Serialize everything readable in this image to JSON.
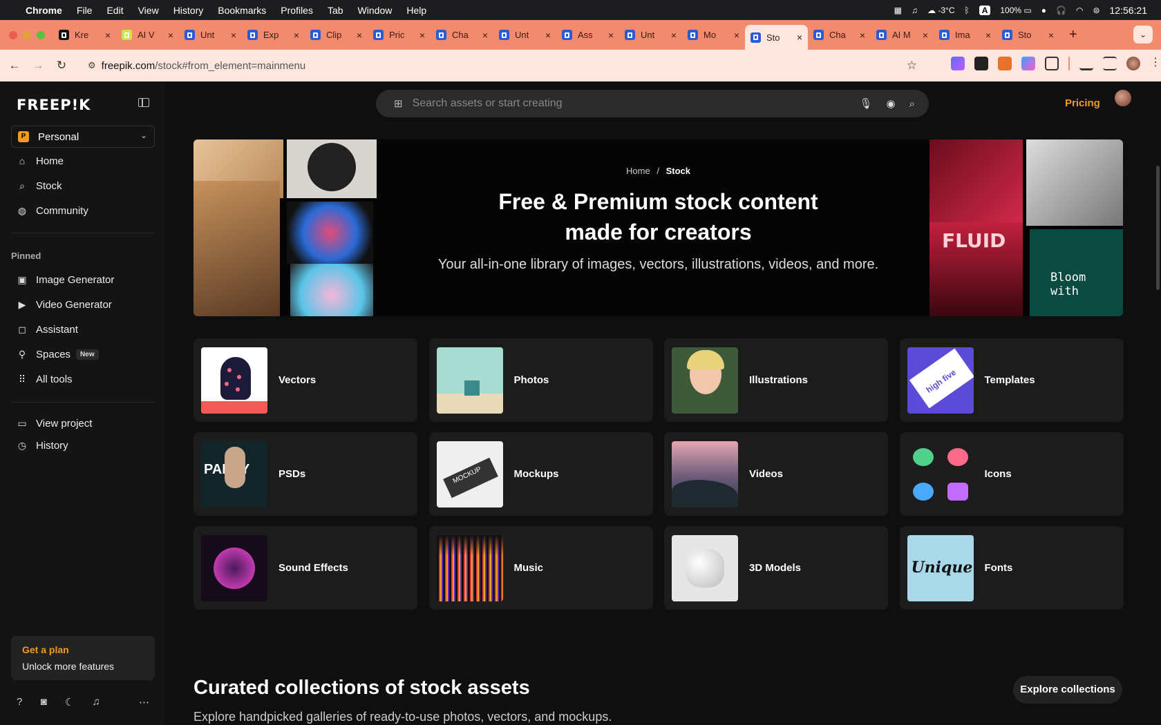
{
  "menubar": {
    "apple": "",
    "items": [
      "Chrome",
      "File",
      "Edit",
      "View",
      "History",
      "Bookmarks",
      "Profiles",
      "Tab",
      "Window",
      "Help"
    ],
    "status": {
      "weather": "-3°C",
      "battery": "100%",
      "clock": "12:56:21"
    }
  },
  "tabs": [
    {
      "label": "Kre",
      "color": "#111"
    },
    {
      "label": "AI V",
      "color": "#c7e84a"
    },
    {
      "label": "Unt",
      "color": "#2a5bd7"
    },
    {
      "label": "Exp",
      "color": "#2a5bd7"
    },
    {
      "label": "Clip",
      "color": "#2a5bd7"
    },
    {
      "label": "Pric",
      "color": "#2a5bd7"
    },
    {
      "label": "Cha",
      "color": "#2a5bd7"
    },
    {
      "label": "Unt",
      "color": "#2a5bd7"
    },
    {
      "label": "Ass",
      "color": "#2a5bd7"
    },
    {
      "label": "Unt",
      "color": "#2a5bd7"
    },
    {
      "label": "Mo",
      "color": "#2a5bd7"
    },
    {
      "label": "Sto",
      "color": "#2a5bd7",
      "active": true
    },
    {
      "label": "Cha",
      "color": "#2a5bd7"
    },
    {
      "label": "AI M",
      "color": "#2a5bd7"
    },
    {
      "label": "Ima",
      "color": "#2a5bd7"
    },
    {
      "label": "Sto",
      "color": "#2a5bd7"
    }
  ],
  "address": {
    "host": "freepik.com",
    "path": "/stock#from_element=mainmenu"
  },
  "sidebar": {
    "logo": "FREEP!K",
    "workspace": {
      "badge": "P",
      "label": "Personal"
    },
    "nav": [
      {
        "label": "Home",
        "icon": "home-icon"
      },
      {
        "label": "Stock",
        "icon": "search-icon"
      },
      {
        "label": "Community",
        "icon": "globe-icon"
      }
    ],
    "pinned_label": "Pinned",
    "pinned": [
      {
        "label": "Image Generator",
        "icon": "image-icon"
      },
      {
        "label": "Video Generator",
        "icon": "video-icon"
      },
      {
        "label": "Assistant",
        "icon": "chat-icon"
      },
      {
        "label": "Spaces",
        "icon": "spaces-icon",
        "badge": "New"
      },
      {
        "label": "All tools",
        "icon": "grid-icon"
      }
    ],
    "project": [
      {
        "label": "View project",
        "icon": "folder-icon"
      },
      {
        "label": "History",
        "icon": "history-icon"
      }
    ],
    "plan": {
      "title": "Get a plan",
      "subtitle": "Unlock more features"
    }
  },
  "header": {
    "search_placeholder": "Search assets or start creating",
    "pricing": "Pricing"
  },
  "hero": {
    "breadcrumb": {
      "home": "Home",
      "sep": "/",
      "current": "Stock"
    },
    "title": "Free & Premium stock content made for creators",
    "subtitle": "Your all-in-one library of images, vectors, illustrations, videos, and more.",
    "art_text": [
      "FLUID",
      "Bloom with"
    ]
  },
  "categories": [
    {
      "label": "Vectors",
      "thumb": "vectors"
    },
    {
      "label": "Photos",
      "thumb": "photos"
    },
    {
      "label": "Illustrations",
      "thumb": "illustrations"
    },
    {
      "label": "Templates",
      "thumb": "templates"
    },
    {
      "label": "PSDs",
      "thumb": "psds"
    },
    {
      "label": "Mockups",
      "thumb": "mockups"
    },
    {
      "label": "Videos",
      "thumb": "videos"
    },
    {
      "label": "Icons",
      "thumb": "icons"
    },
    {
      "label": "Sound Effects",
      "thumb": "sound"
    },
    {
      "label": "Music",
      "thumb": "music"
    },
    {
      "label": "3D Models",
      "thumb": "models"
    },
    {
      "label": "Fonts",
      "thumb": "fonts"
    }
  ],
  "thumb_text": {
    "templates": "high five",
    "psds": "PARTY",
    "mockups": "MOCKUP",
    "fonts": "Unique"
  },
  "collections": {
    "title": "Curated collections of stock assets",
    "subtitle": "Explore handpicked galleries of ready-to-use photos, vectors, and mockups.",
    "button": "Explore collections"
  },
  "colors": {
    "accent": "#f39b1f",
    "tabbar": "#f28a6e",
    "addressbar": "#fde6dd"
  }
}
